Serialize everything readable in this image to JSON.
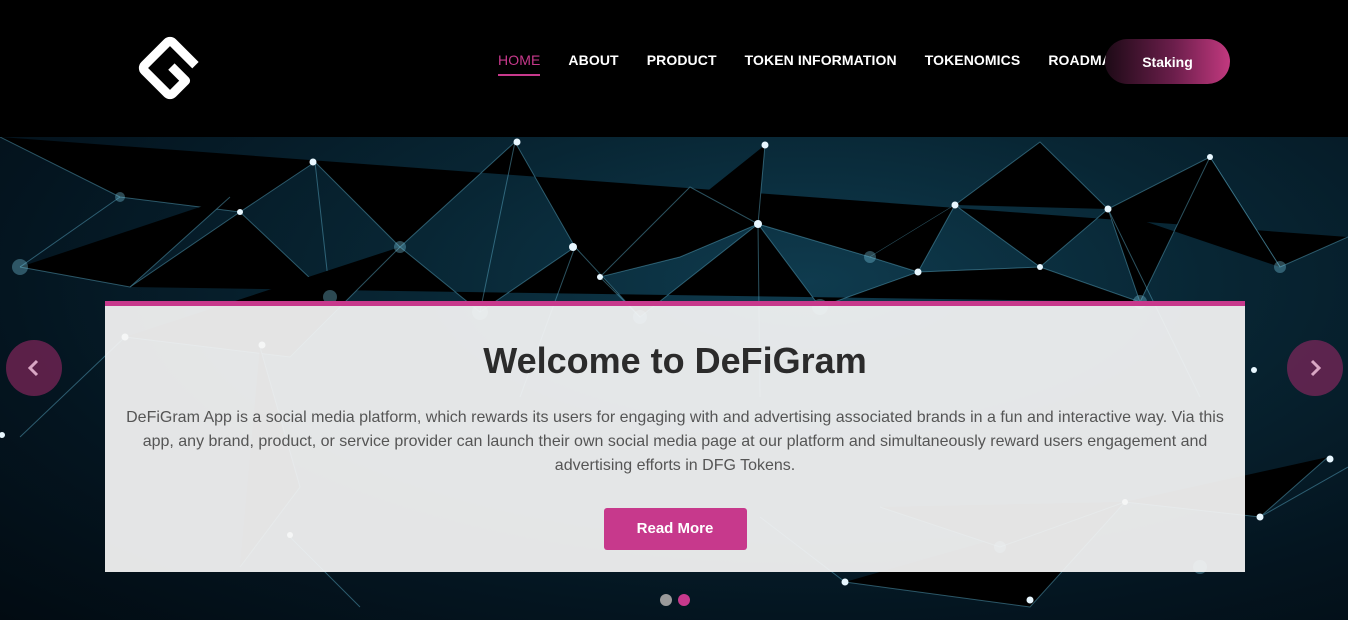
{
  "brand": {
    "logo_icon": "defigram-logo-icon",
    "accent": "#c7398c"
  },
  "nav": {
    "items": [
      {
        "label": "HOME",
        "active": true
      },
      {
        "label": "ABOUT",
        "active": false
      },
      {
        "label": "PRODUCT",
        "active": false
      },
      {
        "label": "TOKEN INFORMATION",
        "active": false
      },
      {
        "label": "TOKENOMICS",
        "active": false
      },
      {
        "label": "ROADMAP",
        "active": false
      }
    ],
    "staking_label": "Staking"
  },
  "hero": {
    "title": "Welcome to DeFiGram",
    "description": "DeFiGram App is a social media platform, which rewards its users for engaging with and advertising associated brands in a fun and interactive way. Via this app, any brand, product, or service provider can launch their own social media page at our platform and simultaneously reward users engagement and advertising efforts in DFG Tokens.",
    "cta_label": "Read More",
    "prev_icon": "chevron-left-icon",
    "next_icon": "chevron-right-icon",
    "slides": [
      {
        "active": false,
        "color": "#9a9a9a"
      },
      {
        "active": true,
        "color": "#c7398c"
      }
    ]
  }
}
